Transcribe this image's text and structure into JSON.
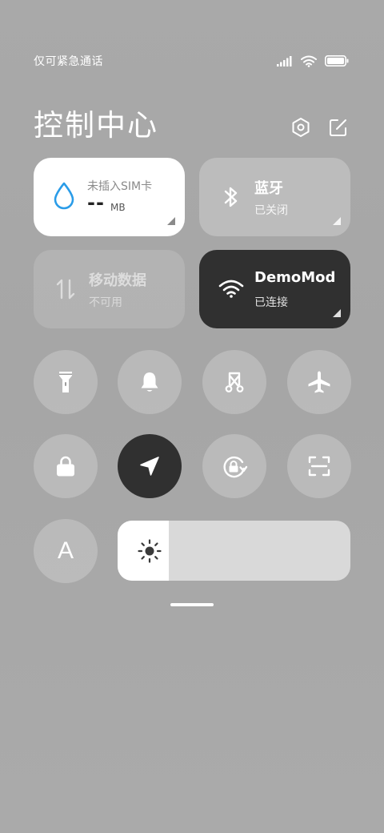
{
  "status_bar": {
    "carrier_text": "仅可紧急通话",
    "icons": [
      "signal-icon",
      "wifi-icon",
      "battery-icon"
    ]
  },
  "header": {
    "title": "控制中心",
    "settings_icon": "settings-hexagon-icon",
    "edit_icon": "edit-icon"
  },
  "tiles": {
    "data_usage": {
      "label": "未插入SIM卡",
      "value": "--",
      "unit": "MB",
      "icon": "water-drop-icon",
      "accent": "#2a9ce8"
    },
    "bluetooth": {
      "title": "蓝牙",
      "status": "已关闭",
      "icon": "bluetooth-icon"
    },
    "mobile_data": {
      "title": "移动数据",
      "status": "不可用",
      "icon": "data-arrows-icon"
    },
    "wifi": {
      "title": "DemoMode",
      "status": "已连接",
      "icon": "wifi-icon"
    }
  },
  "toggles_row1": [
    {
      "id": "flashlight",
      "icon": "flashlight-icon"
    },
    {
      "id": "mute",
      "icon": "bell-icon"
    },
    {
      "id": "screenshot",
      "icon": "scissors-icon"
    },
    {
      "id": "airplane",
      "icon": "airplane-icon"
    }
  ],
  "toggles_row2": [
    {
      "id": "lock",
      "icon": "lock-icon"
    },
    {
      "id": "location",
      "icon": "location-arrow-icon",
      "active": true
    },
    {
      "id": "auto_rotate",
      "icon": "rotate-lock-icon"
    },
    {
      "id": "scan",
      "icon": "scan-icon"
    }
  ],
  "auto_brightness": {
    "label": "A",
    "icon": "auto-brightness-icon"
  },
  "brightness": {
    "level": 0.22,
    "icon": "sun-icon"
  },
  "colors": {
    "active_dark": "#303030",
    "tile_light": "#ffffff",
    "accent_blue": "#2a9ce8"
  }
}
